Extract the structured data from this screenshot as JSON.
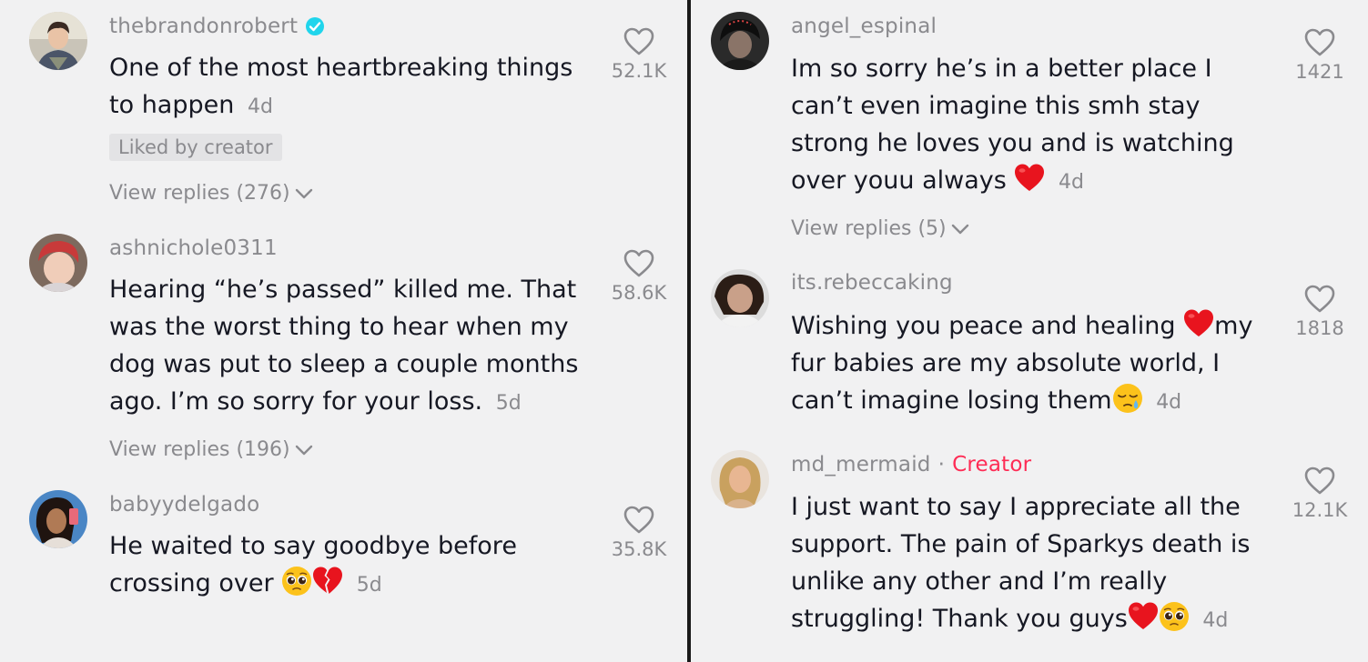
{
  "left_comments": [
    {
      "username": "thebrandonrobert",
      "text": "One of the most heartbreaking things to happen",
      "time": "4d",
      "likes": "52.1K",
      "badge": "Liked by creator",
      "replies": "View replies (276)"
    },
    {
      "username": "ashnichole0311",
      "text": "Hearing “he’s passed” killed me. That was the worst thing to hear when my dog was put to sleep a couple months ago. I’m so sorry for your loss.",
      "time": "5d",
      "likes": "58.6K",
      "replies": "View replies (196)"
    },
    {
      "username": "babyydelgado",
      "text": "He waited to say goodbye before crossing over",
      "time": "5d",
      "likes": "35.8K"
    }
  ],
  "right_comments": [
    {
      "username": "angel_espinal",
      "text": "Im so sorry he’s in a better place I can’t even imagine this smh stay strong he loves you and is watching over youu always",
      "time": "4d",
      "likes": "1421",
      "replies": "View replies (5)"
    },
    {
      "username": "its.rebeccaking",
      "text_part1": "Wishing you peace and healing",
      "text_part2": "my fur babies are my absolute world, I can’t imagine losing them",
      "time": "4d",
      "likes": "1818"
    },
    {
      "username": "md_mermaid",
      "creator_label": "Creator",
      "text": "I just want to say I appreciate all the support. The pain of Sparkys death is unlike any other and I’m really struggling! Thank you guys",
      "time": "4d",
      "likes": "12.1K"
    }
  ],
  "icons": {
    "like": "heart-outline-icon",
    "verified": "verified-badge-icon",
    "expand": "chevron-down-icon"
  },
  "colors": {
    "background": "#f1f1f2",
    "text": "#161823",
    "muted": "#8a8a8e",
    "verified": "#20d5ec",
    "creator": "#fe2c55",
    "heart_emoji": "#e8141e"
  }
}
